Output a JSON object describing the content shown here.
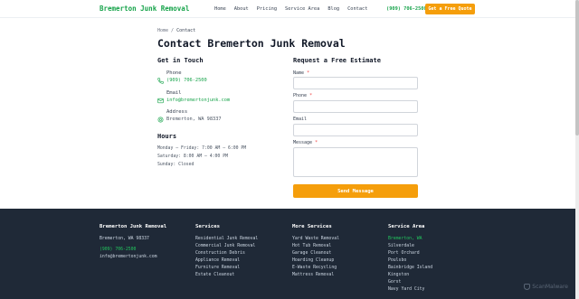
{
  "header": {
    "logo": "Bremerton Junk Removal",
    "nav": [
      "Home",
      "About",
      "Pricing",
      "Service Area",
      "Blog",
      "Contact"
    ],
    "phone": "(909) 706-2500",
    "cta": "Get a Free Quote"
  },
  "breadcrumb": {
    "home": "Home",
    "sep": "/",
    "current": "Contact"
  },
  "page_title": "Contact Bremerton Junk Removal",
  "contact": {
    "heading": "Get in Touch",
    "phone_label": "Phone",
    "phone_value": "(909) 706-2500",
    "email_label": "Email",
    "email_value": "info@bremertonjunk.com",
    "address_label": "Address",
    "address_value": "Bremerton, WA 98337",
    "icons": [
      "phone-icon",
      "mail-icon",
      "location-pin-icon"
    ],
    "accent": "#16a34a"
  },
  "hours": {
    "heading": "Hours",
    "lines": [
      "Monday – Friday: 7:00 AM – 6:00 PM",
      "Saturday: 8:00 AM – 4:00 PM",
      "Sunday: Closed"
    ]
  },
  "form": {
    "heading": "Request a Free Estimate",
    "name_label": "Name",
    "phone_label": "Phone",
    "email_label": "Email",
    "message_label": "Message",
    "required_mark": "*",
    "submit": "Send Message",
    "button_color": "#f59e0b"
  },
  "footer": {
    "brand": {
      "title": "Bremerton Junk Removal",
      "location": "Bremerton, WA 98337",
      "phone": "(909) 706-2500",
      "email": "info@bremertonjunk.com"
    },
    "services": {
      "title": "Services",
      "items": [
        "Residential Junk Removal",
        "Commercial Junk Removal",
        "Construction Debris",
        "Appliance Removal",
        "Furniture Removal",
        "Estate Cleanout"
      ]
    },
    "more_services": {
      "title": "More Services",
      "items": [
        "Yard Waste Removal",
        "Hot Tub Removal",
        "Garage Cleanout",
        "Hoarding Cleanup",
        "E-Waste Recycling",
        "Mattress Removal"
      ]
    },
    "service_area": {
      "title": "Service Area",
      "items": [
        "Bremerton, WA",
        "Silverdale",
        "Port Orchard",
        "Poulsbo",
        "Bainbridge Island",
        "Kingston",
        "Gorst",
        "Navy Yard City"
      ]
    },
    "background": "#1f2937"
  },
  "watermark": "ScanMalware"
}
